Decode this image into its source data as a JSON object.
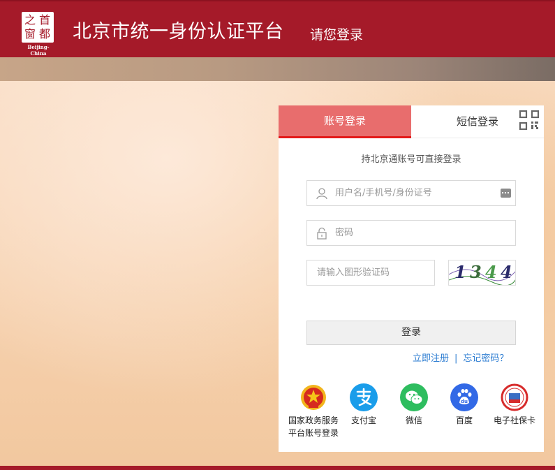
{
  "header": {
    "logo_chars": [
      "之",
      "首",
      "窗",
      "都"
    ],
    "logo_sub": "Beijing-China",
    "title": "北京市统一身份认证平台",
    "subtitle": "请您登录"
  },
  "panel": {
    "tabs": {
      "account": "账号登录",
      "sms": "短信登录"
    },
    "hint": "持北京通账号可直接登录",
    "username_placeholder": "用户名/手机号/身份证号",
    "password_placeholder": "密码",
    "captcha_placeholder": "请输入图形验证码",
    "captcha_chars": [
      "1",
      "3",
      "4",
      "4"
    ],
    "login_label": "登录",
    "register_link": "立即注册",
    "link_separator": "|",
    "forgot_link": "忘记密码？",
    "alt_logins": [
      {
        "label_line1": "国家政务服务",
        "label_line2": "平台账号登录",
        "icon": "national-emblem-icon",
        "color": "#d62a1f"
      },
      {
        "label_line1": "支付宝",
        "icon": "alipay-icon",
        "color": "#1a9dea"
      },
      {
        "label_line1": "微信",
        "icon": "wechat-icon",
        "color": "#2ebd5f"
      },
      {
        "label_line1": "百度",
        "icon": "baidu-icon",
        "color": "#3269e6"
      },
      {
        "label_line1": "电子社保卡",
        "icon": "social-security-icon",
        "color": "#d72b2b"
      }
    ]
  },
  "colors": {
    "brand": "#a51a29",
    "active_tab": "#e86d6d",
    "link": "#2d7dd2"
  }
}
